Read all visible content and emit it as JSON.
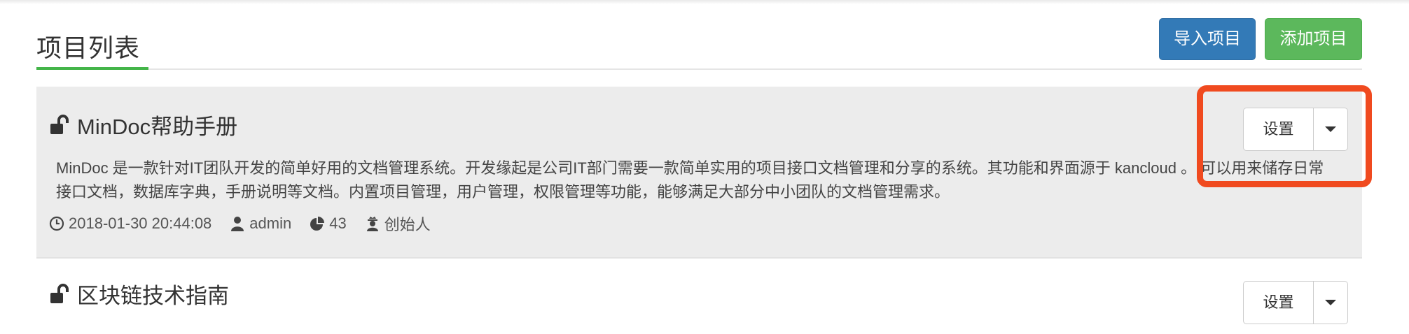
{
  "header": {
    "title": "项目列表",
    "import_label": "导入项目",
    "add_label": "添加项目"
  },
  "projects": [
    {
      "name": "MinDoc帮助手册",
      "description": "MinDoc 是一款针对IT团队开发的简单好用的文档管理系统。开发缘起是公司IT部门需要一款简单实用的项目接口文档管理和分享的系统。其功能和界面源于 kancloud 。 可以用来储存日常接口文档，数据库字典，手册说明等文档。内置项目管理，用户管理，权限管理等功能，能够满足大部分中小团队的文档管理需求。",
      "created": "2018-01-30 20:44:08",
      "author": "admin",
      "doc_count": "43",
      "role": "创始人",
      "settings_label": "设置"
    },
    {
      "name": "区块链技术指南",
      "settings_label": "设置"
    }
  ],
  "colors": {
    "primary": "#337ab7",
    "success": "#5cb85c",
    "accent_underline": "#44b549",
    "highlight": "#f04a1f"
  },
  "icons": {
    "lock": "unlock-icon",
    "time": "clock-icon",
    "user": "user-icon",
    "docs": "pie-chart-icon",
    "role": "user-secret-icon",
    "dropdown": "caret-down-icon"
  }
}
